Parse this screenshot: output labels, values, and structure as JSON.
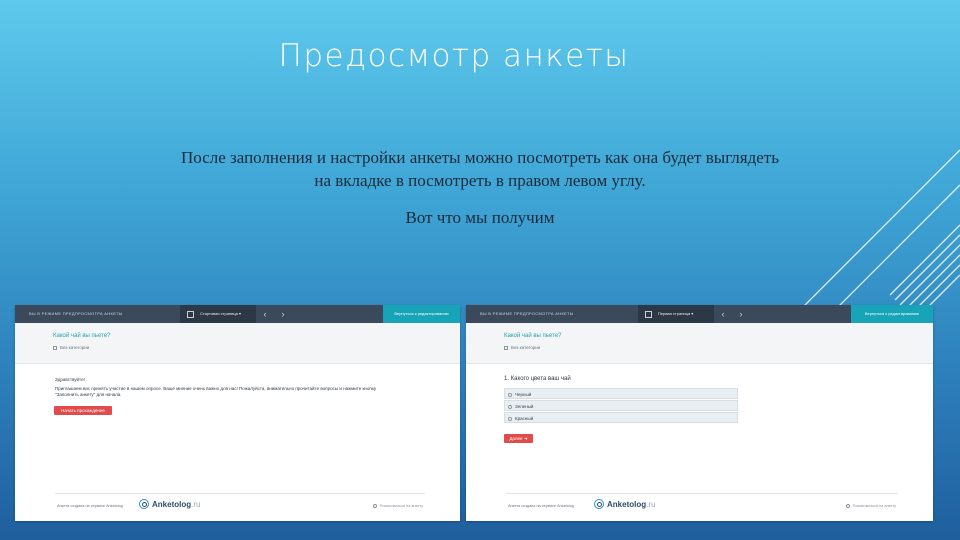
{
  "slide": {
    "title": "Предосмотр анкеты",
    "line1": "После заполнения и настройки анкеты можно посмотреть как она будет выглядеть",
    "line2": "на вкладке в посмотреть в правом левом углу.",
    "line3": "Вот что мы получим"
  },
  "left": {
    "breadcrumb": "Вы в режиме предпросмотра анкеты",
    "page_selector": "Стартовая страница",
    "prev_icon": "chevron-left-icon",
    "next_icon": "chevron-right-icon",
    "return_label": "Вернуться к редактированию",
    "survey_title": "Какой чай вы пьете?",
    "survey_subtitle": "Без категории",
    "greeting_title": "Здравствуйте!",
    "greeting_text": "Приглашаем вас принять участие в нашем опросе. Ваше мнение очень важно для нас! Пожалуйста, внимательно прочитайте вопросы и нажмите кнопку \"Заполнить анкету\" для начала.",
    "start_button": "Начать прохождение анкеты",
    "made_with": "Анкета создана на сервисе Anketolog",
    "logo_word": "Anketolog",
    "logo_tld": ".ru",
    "report": "Пожаловаться на анкету"
  },
  "right": {
    "breadcrumb": "Вы в режиме предпросмотра анкеты",
    "page_selector": "Первая страница",
    "prev_icon": "chevron-left-icon",
    "next_icon": "chevron-right-icon",
    "return_label": "Вернуться к редактированию",
    "survey_title": "Какой чай вы пьете?",
    "survey_subtitle": "Без категории",
    "question": "1. Какого цвета ваш чай",
    "options": [
      "Черный",
      "Зеленый",
      "Красный"
    ],
    "next_button": "Далее",
    "made_with": "Анкета создана на сервисе Anketolog",
    "logo_word": "Anketolog",
    "logo_tld": ".ru",
    "report": "Пожаловаться на анкету"
  }
}
